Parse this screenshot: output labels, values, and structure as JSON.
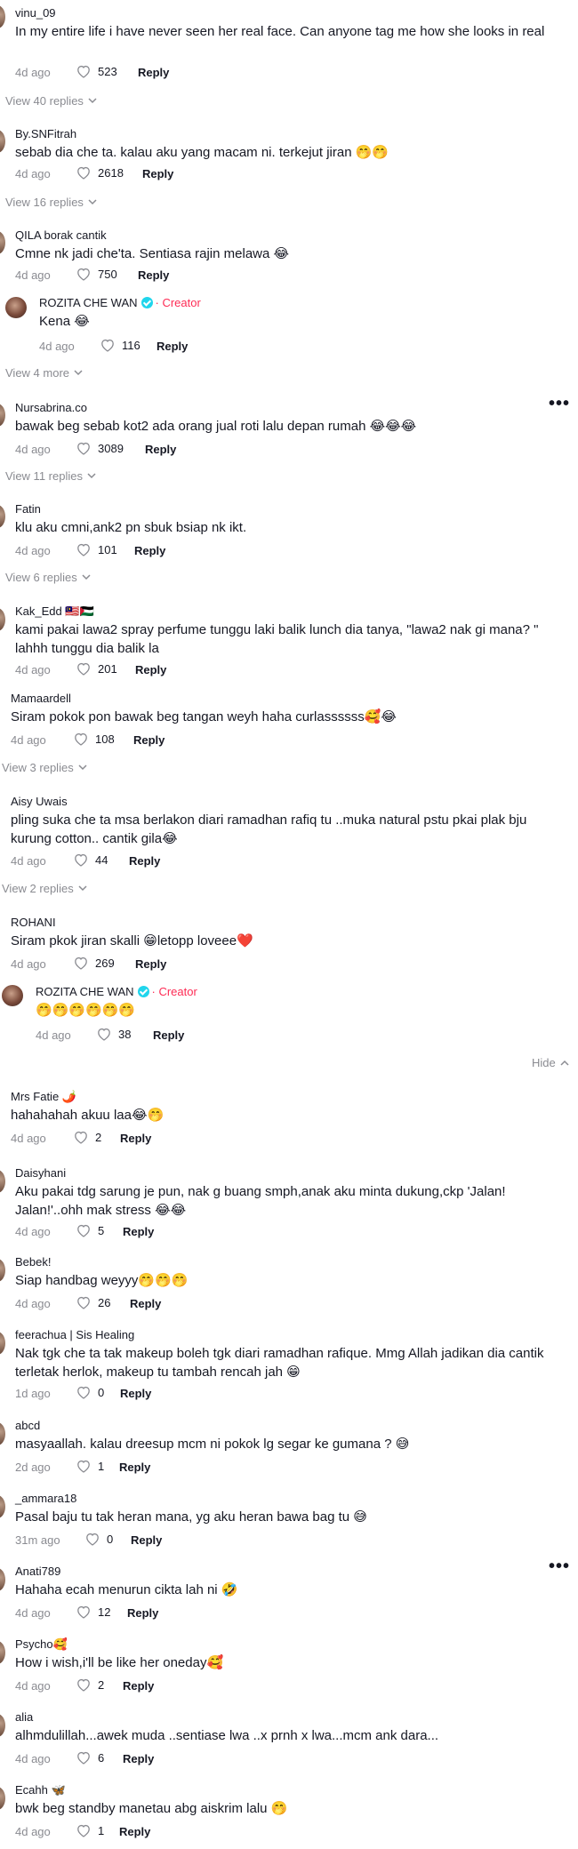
{
  "common": {
    "reply_label": "Reply",
    "creator_label": "· Creator"
  },
  "comments": [
    {
      "user": "vinu_09",
      "text": "In my entire life i have never seen her real face. Can anyone tag me how she looks in real",
      "date": "4d ago",
      "likes": "523"
    },
    {
      "user": "By.SNFitrah",
      "text": "sebab dia che ta. kalau aku yang macam ni. terkejut jiran 🤭🤭",
      "date": "4d ago",
      "likes": "2618"
    },
    {
      "user": "QILA borak cantik",
      "text": "Cmne nk jadi che'ta. Sentiasa rajin melawa 😂",
      "date": "4d ago",
      "likes": "750"
    },
    {
      "user": "ROZITA CHE WAN",
      "text": "Kena 😂",
      "date": "4d ago",
      "likes": "116"
    },
    {
      "user": "Nursabrina.co",
      "text": "bawak beg sebab kot2 ada orang jual roti lalu depan rumah 😂😂😂",
      "date": "4d ago",
      "likes": "3089"
    },
    {
      "user": "Fatin",
      "text": "klu aku cmni,ank2 pn sbuk bsiap nk ikt.",
      "date": "4d ago",
      "likes": "101"
    },
    {
      "user": "Kak_Edd 🇲🇾🇵🇸",
      "text": "kami pakai lawa2 spray perfume tunggu laki balik lunch dia tanya, \"lawa2 nak gi mana? \" lahhh tunggu dia balik la",
      "date": "4d ago",
      "likes": "201"
    },
    {
      "user": "Mamaardell",
      "text": "Siram pokok pon bawak beg tangan weyh haha curlassssss🥰😂",
      "date": "4d ago",
      "likes": "108"
    },
    {
      "user": "Aisy Uwais",
      "text": "pling suka che ta msa berlakon diari ramadhan rafiq tu ..muka natural pstu pkai plak bju kurung cotton.. cantik gila😂",
      "date": "4d ago",
      "likes": "44"
    },
    {
      "user": "ROHANI",
      "text": "Siram pkok jiran skalli 😁letopp loveee❤️",
      "date": "4d ago",
      "likes": "269"
    },
    {
      "user": "ROZITA CHE WAN",
      "text": "🤭🤭🤭🤭🤭🤭",
      "date": "4d ago",
      "likes": "38"
    },
    {
      "user": "Mrs Fatie 🌶️",
      "text": "hahahahah akuu laa😂🤭",
      "date": "4d ago",
      "likes": "2"
    },
    {
      "user": "Daisyhani",
      "text": "Aku pakai tdg sarung je pun, nak g buang smph,anak aku minta dukung,ckp 'Jalan! Jalan!'..ohh mak stress 😂😂",
      "date": "4d ago",
      "likes": "5"
    },
    {
      "user": "Bebek!",
      "text": "Siap handbag weyyy🤭🤭🤭",
      "date": "4d ago",
      "likes": "26"
    },
    {
      "user": "feerachua | Sis Healing",
      "text": "Nak tgk che ta tak makeup boleh tgk diari ramadhan rafique. Mmg Allah jadikan dia cantik terletak herlok, makeup tu tambah rencah jah 😁",
      "date": "1d ago",
      "likes": "0"
    },
    {
      "user": "abcd",
      "text": "masyaallah. kalau dreesup mcm ni pokok lg segar ke gumana ? 😅",
      "date": "2d ago",
      "likes": "1"
    },
    {
      "user": "_ammara18",
      "text": "Pasal baju tu tak heran mana, yg aku heran bawa bag tu 😅",
      "date": "31m ago",
      "likes": "0"
    },
    {
      "user": "Anati789",
      "text": "Hahaha ecah menurun cikta lah ni 🤣",
      "date": "4d ago",
      "likes": "12"
    },
    {
      "user": "Psycho🥰",
      "text": "How i wish,i'll be like her oneday🥰",
      "date": "4d ago",
      "likes": "2"
    },
    {
      "user": "alia",
      "text": "alhmdulillah...awek muda ..sentiase lwa ..x prnh x lwa...mcm ank dara...",
      "date": "4d ago",
      "likes": "6"
    },
    {
      "user": "Ecahh 🦋",
      "text": "bwk beg standby manetau abg aiskrim lalu 🤭",
      "date": "4d ago",
      "likes": "1"
    }
  ],
  "view_replies": [
    "View 40 replies",
    "View 16 replies",
    "View 4 more",
    "View 11 replies",
    "View 6 replies",
    "View 3 replies",
    "View 2 replies"
  ],
  "hide_label": "Hide",
  "colors": {
    "text": "#161823",
    "secondary": "#8a8b91",
    "creator": "#fe2c55",
    "verified": "#20d5ec"
  },
  "icons": {
    "like": "heart-outline-icon",
    "expand": "chevron-down-icon",
    "collapse": "chevron-up-icon",
    "more": "more-horizontal-icon",
    "verified": "verified-badge-icon"
  }
}
